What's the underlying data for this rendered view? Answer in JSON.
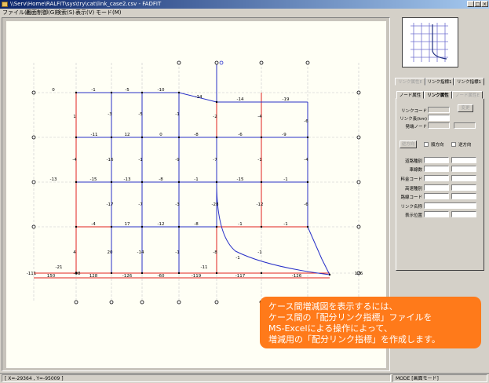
{
  "window": {
    "title": "\\\\Serv\\Home\\RALFIT\\sys\\try\\cat\\link_case2.csv - FADFIT",
    "controls": {
      "minimize": "_",
      "maximize": "□",
      "close": "×"
    }
  },
  "menu": [
    {
      "label": "ファイル(F)"
    },
    {
      "label": "画面制御(G)"
    },
    {
      "label": "検索(S)"
    },
    {
      "label": "表示(V)"
    },
    {
      "label": "モード(M)"
    }
  ],
  "map": {
    "link_labels": [
      "0",
      "-1",
      "-5",
      "-10",
      "-14",
      "-14",
      "-19",
      "1",
      "-3",
      "-5",
      "-1",
      "-2",
      "-4",
      "-6",
      "-11",
      "12",
      "0",
      "-8",
      "-6",
      "-9",
      "-4",
      "-16",
      "-1",
      "-9",
      "-7",
      "-1",
      "-4",
      "-13",
      "-15",
      "-13",
      "-8",
      "-1",
      "-15",
      "-1",
      "-17",
      "-7",
      "-3",
      "-28",
      "-12",
      "-6",
      "-4",
      "17",
      "-12",
      "-8",
      "-1",
      "-1",
      "4",
      "20",
      "-14",
      "-1",
      "-8",
      "-1",
      "-1",
      "-11",
      "-21",
      "150",
      "128",
      "-126",
      "-60",
      "-119",
      "-117",
      "-126",
      "-111",
      "-98",
      "126",
      "32",
      "-1"
    ]
  },
  "panel": {
    "top_tabs": [
      "リンク属性E",
      "リンク指標1",
      "リンク指標1"
    ],
    "sub_tabs": [
      "ノード属性",
      "リンク属性",
      "ノード属性E"
    ],
    "fields": {
      "link_code": "リンクコード",
      "link_length": "リンク長(km)",
      "start_node": "発端ノード",
      "road_type": "道路種別",
      "lanes": "車線数",
      "fare": "料金コード",
      "class": "高速種別",
      "route": "路線コード",
      "link_name": "リンク名称",
      "display_pos": "表示位置"
    },
    "buttons": {
      "apply": "変更",
      "reverse": "逆方向"
    },
    "checkboxes": {
      "forward": "順方向",
      "backward": "逆方向"
    }
  },
  "status": {
    "coords": "[ X=-29364 , Y=-95009 ]",
    "mode": "MODE [画面モード]"
  },
  "callout": {
    "lines": [
      "ケース間増減図を表示するには、",
      "ケース間の「配分リンク指標」ファイルを",
      "MS-Excelによる操作によって、",
      "増減用の「配分リンク指標」を作成します。"
    ]
  },
  "colors": {
    "blue_link": "#2830c8",
    "red_link": "#e02020",
    "callout": "#ff7a1a",
    "titlebar": "#0a246a"
  }
}
